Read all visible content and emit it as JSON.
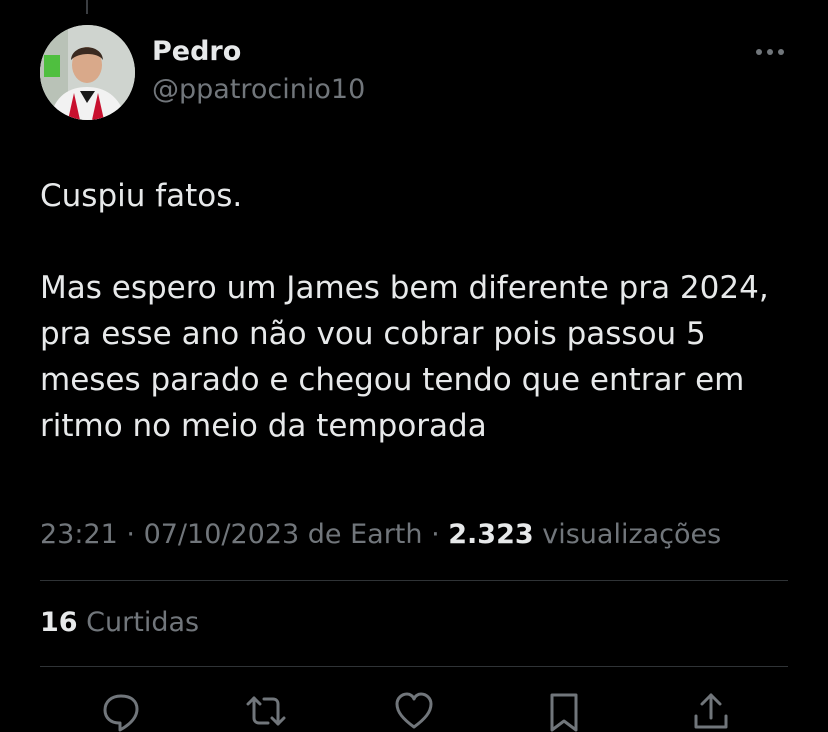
{
  "author": {
    "display_name": "Pedro",
    "handle": "@ppatrocinio10"
  },
  "tweet": {
    "line1": "Cuspiu fatos.",
    "line2": "Mas espero um James bem diferente pra 2024, pra esse ano não vou cobrar pois passou 5 meses parado e chegou tendo que entrar em ritmo no meio da temporada"
  },
  "meta": {
    "time": "23:21",
    "separator": " · ",
    "date": "07/10/2023",
    "source": " de Earth",
    "separator2": " · ",
    "views_count": "2.323",
    "views_label": " visualizações"
  },
  "likes": {
    "count": "16",
    "label": " Curtidas"
  },
  "icons": [
    "more-icon",
    "reply-icon",
    "retweet-icon",
    "like-icon",
    "bookmark-icon",
    "share-icon"
  ],
  "colors": {
    "background": "#000000",
    "text_primary": "#e7e9ea",
    "text_secondary": "#71767b",
    "divider": "#2f3336"
  }
}
